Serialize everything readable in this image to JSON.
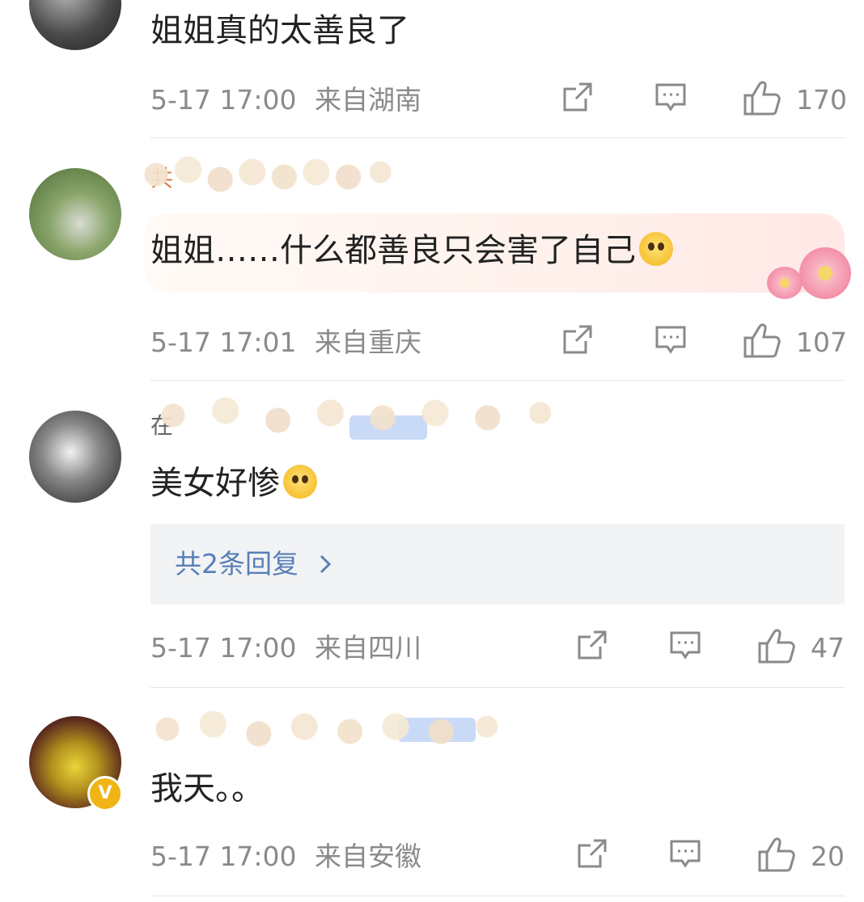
{
  "comments": [
    {
      "text": "姐姐真的太善良了",
      "time": "5-17 17:00",
      "location": "来自湖南",
      "likes": "170"
    },
    {
      "username_partial": "共",
      "text": "姐姐……什么都善良只会害了自己",
      "emoji": "flushed-face",
      "time": "5-17 17:01",
      "location": "来自重庆",
      "likes": "107"
    },
    {
      "username_partial": "在",
      "text": "美女好惨",
      "emoji": "flushed-face",
      "replies_label": "共2条回复",
      "time": "5-17 17:00",
      "location": "来自四川",
      "likes": "47"
    },
    {
      "text": "我天。。",
      "verified": "V",
      "time": "5-17 17:00",
      "location": "来自安徽",
      "likes": "20"
    }
  ],
  "icons": {
    "share": "share-icon",
    "comment": "comment-icon",
    "like": "thumbs-up-icon",
    "replies_arrow": "chevron-right-icon"
  },
  "colors": {
    "meta_text": "#8a8a8a",
    "reply_link": "#5a7fb8",
    "username_orange": "#e2752e",
    "vip_badge": "#f1b415"
  }
}
